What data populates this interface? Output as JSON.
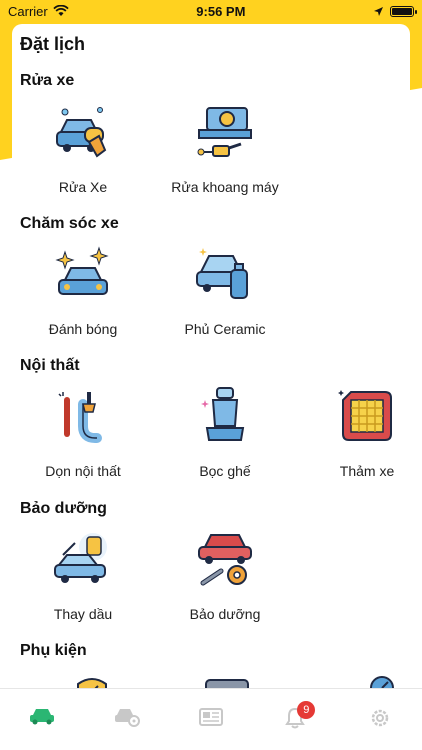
{
  "status_bar": {
    "carrier": "Carrier",
    "time": "9:56 PM"
  },
  "page": {
    "title": "Đặt lịch"
  },
  "sections": [
    {
      "title": "Rửa xe",
      "items": [
        {
          "label": "Rửa Xe",
          "icon": "car-wash-icon"
        },
        {
          "label": "Rửa khoang máy",
          "icon": "engine-wash-icon"
        }
      ]
    },
    {
      "title": "Chăm sóc xe",
      "items": [
        {
          "label": "Đánh bóng",
          "icon": "polish-icon"
        },
        {
          "label": "Phủ Ceramic",
          "icon": "ceramic-icon"
        }
      ]
    },
    {
      "title": "Nội thất",
      "items": [
        {
          "label": "Dọn nội thất",
          "icon": "interior-cleaning-icon"
        },
        {
          "label": "Bọc ghế",
          "icon": "seat-cover-icon"
        },
        {
          "label": "Thảm xe",
          "icon": "car-mat-icon"
        }
      ]
    },
    {
      "title": "Bảo dưỡng",
      "items": [
        {
          "label": "Thay dầu",
          "icon": "oil-change-icon"
        },
        {
          "label": "Bảo dưỡng",
          "icon": "maintenance-icon"
        }
      ]
    },
    {
      "title": "Phụ kiện",
      "items": []
    }
  ],
  "tabbar": {
    "notification_count": "9"
  },
  "colors": {
    "accent": "#ffd21f",
    "active_tab": "#2bb673",
    "inactive_tab": "#c8c8c8",
    "badge": "#e53935"
  }
}
